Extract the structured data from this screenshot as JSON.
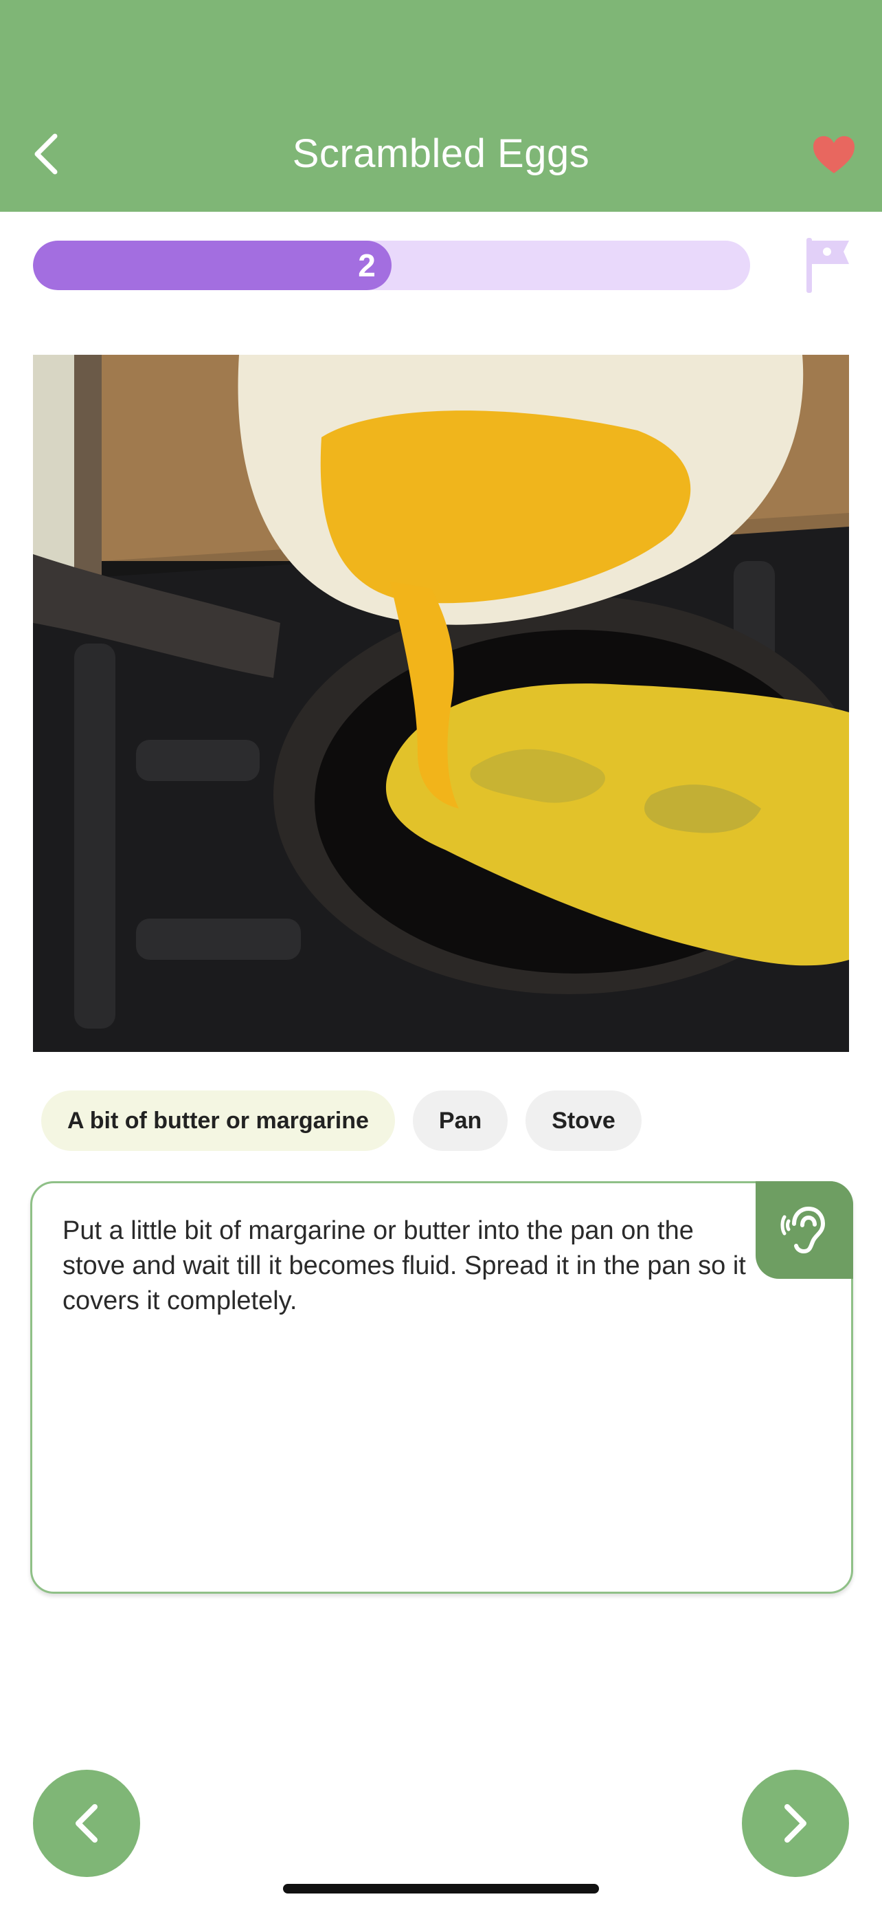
{
  "header": {
    "title": "Scrambled Eggs",
    "back_icon": "chevron-left-icon",
    "favorite_icon": "heart-icon",
    "background_color": "#7fb676",
    "favorite_color": "#e8675f"
  },
  "progress": {
    "current_step_label": "2",
    "fraction": 0.5,
    "fill_color": "#a36ee0",
    "track_color": "#e9d9fb",
    "end_icon": "flag-icon"
  },
  "step_image": {
    "description_icon": "photo-eggs-pouring-into-pan"
  },
  "ingredients": [
    {
      "label": "A bit of butter or margarine"
    },
    {
      "label": "Pan"
    },
    {
      "label": "Stove"
    }
  ],
  "instruction": {
    "text": "Put a little bit of margarine or butter into the pan on the stove and wait till it becomes fluid. Spread it in the pan so it covers it completely.",
    "listen_icon": "ear-icon"
  },
  "navigation": {
    "prev_icon": "chevron-left-icon",
    "next_icon": "chevron-right-icon"
  }
}
